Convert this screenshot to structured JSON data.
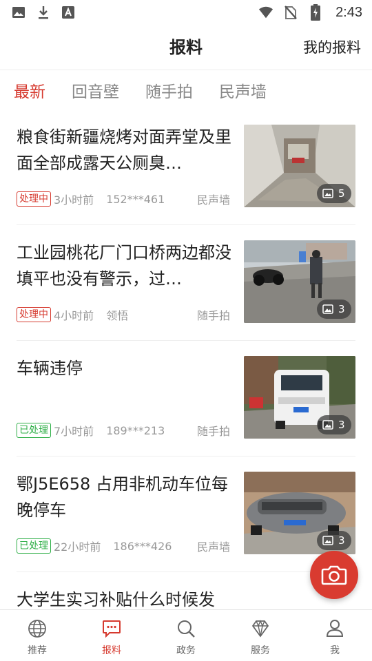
{
  "status_bar": {
    "time": "2:43",
    "left_icons": [
      "image-icon",
      "download-icon",
      "font-icon"
    ],
    "right_icons": [
      "wifi-icon",
      "no-sim-icon",
      "battery-charging-icon"
    ]
  },
  "header": {
    "title": "报料",
    "right_link": "我的报料"
  },
  "tabs": [
    {
      "label": "最新",
      "active": true
    },
    {
      "label": "回音壁",
      "active": false
    },
    {
      "label": "随手拍",
      "active": false
    },
    {
      "label": "民声墙",
      "active": false
    }
  ],
  "feed": [
    {
      "title": "粮食街新疆烧烤对面弄堂及里面全部成露天公厕臭…",
      "status": "处理中",
      "status_type": "processing",
      "time": "3小时前",
      "user": "152***461",
      "category": "民声墙",
      "photo_count": "5"
    },
    {
      "title": "工业园桃花厂门口桥两边都没填平也没有警示，过…",
      "status": "处理中",
      "status_type": "processing",
      "time": "4小时前",
      "user": "领悟",
      "category": "随手拍",
      "photo_count": "3"
    },
    {
      "title": "车辆违停",
      "status": "已处理",
      "status_type": "done",
      "time": "7小时前",
      "user": "189***213",
      "category": "随手拍",
      "photo_count": "3"
    },
    {
      "title": "鄂J5E658 占用非机动车位每晚停车",
      "status": "已处理",
      "status_type": "done",
      "time": "22小时前",
      "user": "186***426",
      "category": "民声墙",
      "photo_count": "3"
    },
    {
      "title": "大学生实习补贴什么时候发"
    }
  ],
  "fab": {
    "icon": "camera-icon",
    "color": "#d93b30"
  },
  "bottom_nav": [
    {
      "label": "推荐",
      "icon": "globe-icon",
      "active": false
    },
    {
      "label": "报料",
      "icon": "chat-icon",
      "active": true
    },
    {
      "label": "政务",
      "icon": "search-icon",
      "active": false
    },
    {
      "label": "服务",
      "icon": "diamond-icon",
      "active": false
    },
    {
      "label": "我",
      "icon": "user-icon",
      "active": false
    }
  ],
  "colors": {
    "accent": "#d63a2f",
    "done": "#2cae45"
  }
}
